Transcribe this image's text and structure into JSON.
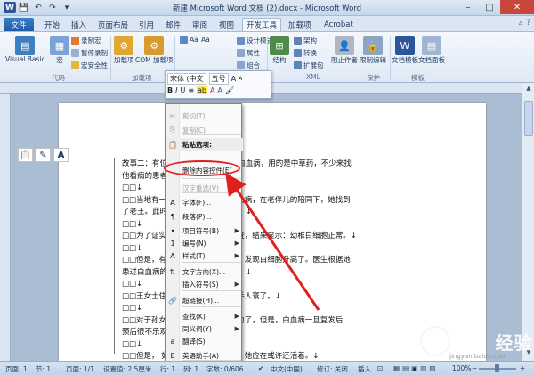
{
  "window": {
    "title": "新建 Microsoft Word 文档 (2).docx - Microsoft Word",
    "app_logo": "W",
    "colors": {
      "accent": "#2b579a",
      "file_tab": "#1e5aa8",
      "annotation": "#e0201e",
      "close": "#c9463d"
    }
  },
  "tabs": [
    "文件",
    "开始",
    "插入",
    "页面布局",
    "引用",
    "邮件",
    "审阅",
    "视图",
    "开发工具",
    "加载项",
    "Acrobat"
  ],
  "ribbon": {
    "groups": {
      "code": "代码",
      "addins": "加载项",
      "controls": "控件",
      "xml": "XML",
      "protect": "保护",
      "templates": "模板"
    },
    "buttons": {
      "visual_basic": "Visual Basic",
      "macro": "宏",
      "record_macro": "录制宏",
      "pause_record": "暂停录制",
      "macro_security": "宏安全性",
      "addins": "加载项",
      "com_addins": "COM 加载项",
      "design_mode": "设计模式",
      "properties": "属性",
      "group": "组合",
      "structure": "结构",
      "schema": "架构",
      "transform": "转换",
      "expansion_pack": "扩展包",
      "block_authors": "阻止作者",
      "restrict_editing": "限制编辑",
      "document_template": "文档模板",
      "document_panel": "文档面板"
    }
  },
  "mini_toolbar": {
    "font_name": "宋体 (中文",
    "font_size": "五号",
    "buttons": [
      "B",
      "I",
      "U",
      "≡",
      "A",
      "A"
    ]
  },
  "context_menu": {
    "items": [
      {
        "label": "剪切(T)",
        "disabled": true,
        "icon": "scissors-icon",
        "glyph": "✂"
      },
      {
        "label": "复制(C)",
        "disabled": true,
        "icon": "copy-icon",
        "glyph": "⎘"
      },
      {
        "label": "粘贴选项:",
        "header": true,
        "icon": "clipboard-icon",
        "glyph": "📋"
      },
      {
        "label": "删除内容控件(E)",
        "disabled": false,
        "icon": "",
        "glyph": ""
      },
      {
        "label": "汉字重选(V)",
        "disabled": true,
        "icon": "",
        "glyph": ""
      },
      {
        "label": "字体(F)...",
        "disabled": false,
        "icon": "font-icon",
        "glyph": "A"
      },
      {
        "label": "段落(P)...",
        "disabled": false,
        "icon": "paragraph-icon",
        "glyph": "¶"
      },
      {
        "label": "项目符号(B)",
        "disabled": false,
        "icon": "bullets-icon",
        "glyph": "•",
        "submenu": true
      },
      {
        "label": "编号(N)",
        "disabled": false,
        "icon": "numbering-icon",
        "glyph": "1",
        "submenu": true
      },
      {
        "label": "样式(T)",
        "disabled": false,
        "icon": "styles-icon",
        "glyph": "A",
        "submenu": true
      },
      {
        "label": "文字方向(X)...",
        "disabled": false,
        "icon": "text-direction-icon",
        "glyph": "⇅"
      },
      {
        "label": "插入符号(S)",
        "disabled": false,
        "icon": "",
        "glyph": "",
        "submenu": true
      },
      {
        "label": "超链接(H)...",
        "disabled": false,
        "icon": "hyperlink-icon",
        "glyph": "🔗"
      },
      {
        "label": "查找(K)",
        "disabled": false,
        "icon": "",
        "glyph": "",
        "submenu": true
      },
      {
        "label": "同义词(Y)",
        "disabled": false,
        "icon": "",
        "glyph": "",
        "submenu": true
      },
      {
        "label": "翻译(S)",
        "disabled": false,
        "icon": "translate-icon",
        "glyph": "a"
      },
      {
        "label": "英语助手(A)",
        "disabled": false,
        "icon": "english-assistant-icon",
        "glyph": "E"
      },
      {
        "label": "其他操作(A)",
        "disabled": false,
        "icon": "",
        "glyph": "",
        "submenu": true
      }
    ],
    "paste_options": [
      "📋",
      "✎",
      "A"
    ]
  },
  "document": {
    "lines": [
      "故事二：有位                                    师的资质，却会治疗白血病，用的是中草药，不少来找",
      "他看病的患者",
      "□□↓",
      "□□当地有一                                    。医院诊断她患了白血病，在老伴儿的陪同下，她找到",
      "了老王。此时                                    ，后来症状就没有了。↓",
      "□□↓",
      "□□为了证实                                    医院做了骨髓穿刺检查，结果显示：幼稚白细胞正常。↓",
      "□□↓",
      "□□但是，有                                    发热，遂去医院检查，发现白细胞升高了。医生根据她",
      "患过白血病的                                    发，赢其住院治化疗。↓",
      "□□↓",
      "□□王女士住                                    疗了一个疗程，就撒手人寰了。↓",
      "□□↓",
      "□□对于孙女                                    医院在治疗上已经尽力了，但是，白血病一旦复发后",
      "预后很不乐观                                    孙女士没有例外。↓",
      "□□↓",
      "□□但是，                                    如果不给老伴儿做化疗，她应在或许还活着。↓",
      "□□↓"
    ]
  },
  "statusbar": {
    "page": "页面: 1",
    "section": "节: 1",
    "page_of": "页面: 1/1",
    "setting": "设置值: 2.5厘米",
    "row": "行: 1",
    "col": "列: 1",
    "words": "字数: 0/606",
    "language": "中文(中国)",
    "mode": "修订: 关闭",
    "insert": "插入",
    "zoom": "100%"
  },
  "watermark": {
    "text": "Bai 经验",
    "sub": "jingyan.baidu.com"
  }
}
